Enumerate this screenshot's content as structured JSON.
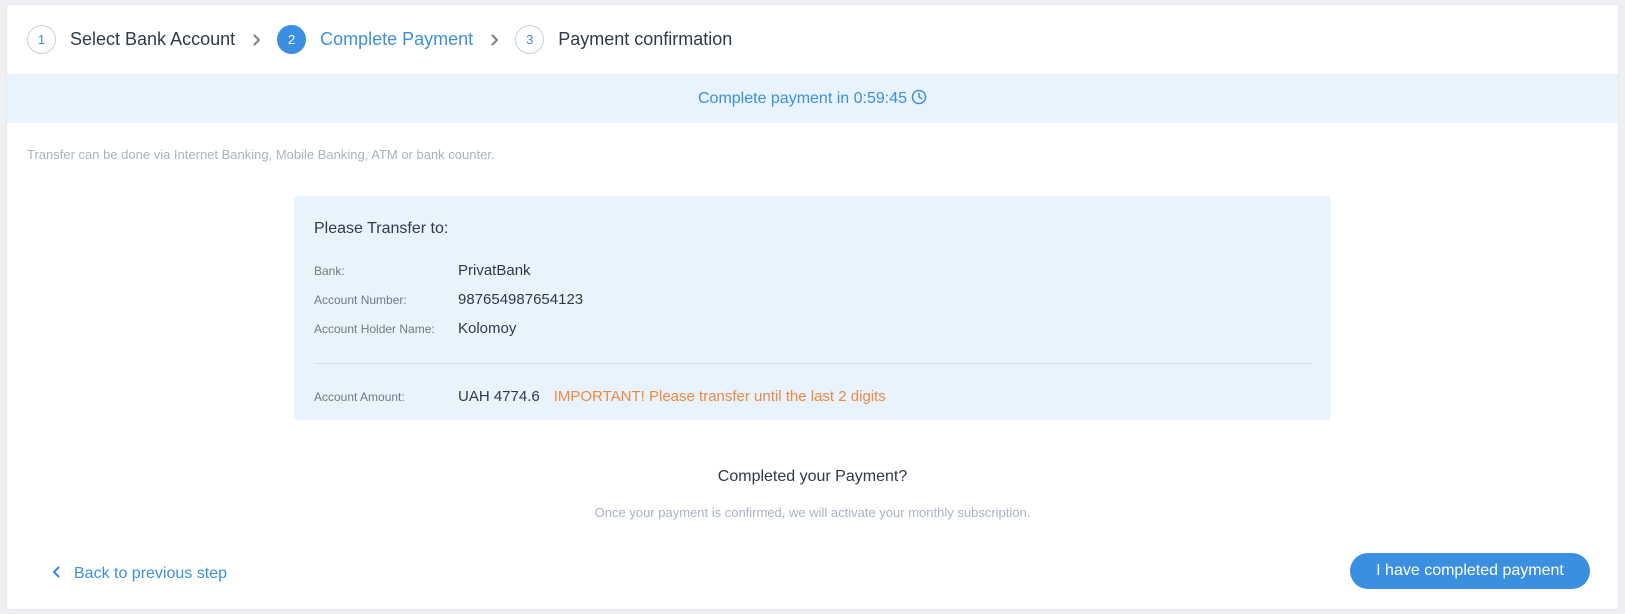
{
  "stepper": {
    "steps": [
      {
        "number": "1",
        "label": "Select Bank Account"
      },
      {
        "number": "2",
        "label": "Complete Payment"
      },
      {
        "number": "3",
        "label": "Payment confirmation"
      }
    ]
  },
  "timer": {
    "text": "Complete payment in 0:59:45",
    "icon": "clock-icon"
  },
  "note": "Transfer can be done via Internet Banking, Mobile Banking, ATM or bank counter.",
  "transfer": {
    "title": "Please Transfer to:",
    "bank_label": "Bank:",
    "bank_value": "PrivatBank",
    "account_number_label": "Account Number:",
    "account_number_value": "987654987654123",
    "holder_label": "Account Holder Name:",
    "holder_value": "Kolomoy",
    "amount_label": "Account Amount:",
    "amount_value": "UAH 4774.6",
    "important": "IMPORTANT! Please transfer until the last 2 digits"
  },
  "completed": {
    "title": "Completed your Payment?",
    "subtitle": "Once your payment is confirmed, we will activate your monthly subscription."
  },
  "actions": {
    "back_label": "Back to previous step",
    "confirm_label": "I have completed payment"
  },
  "colors": {
    "accent": "#3b8fe0",
    "warning": "#f0883e",
    "banner_bg": "#e8f3fd"
  }
}
